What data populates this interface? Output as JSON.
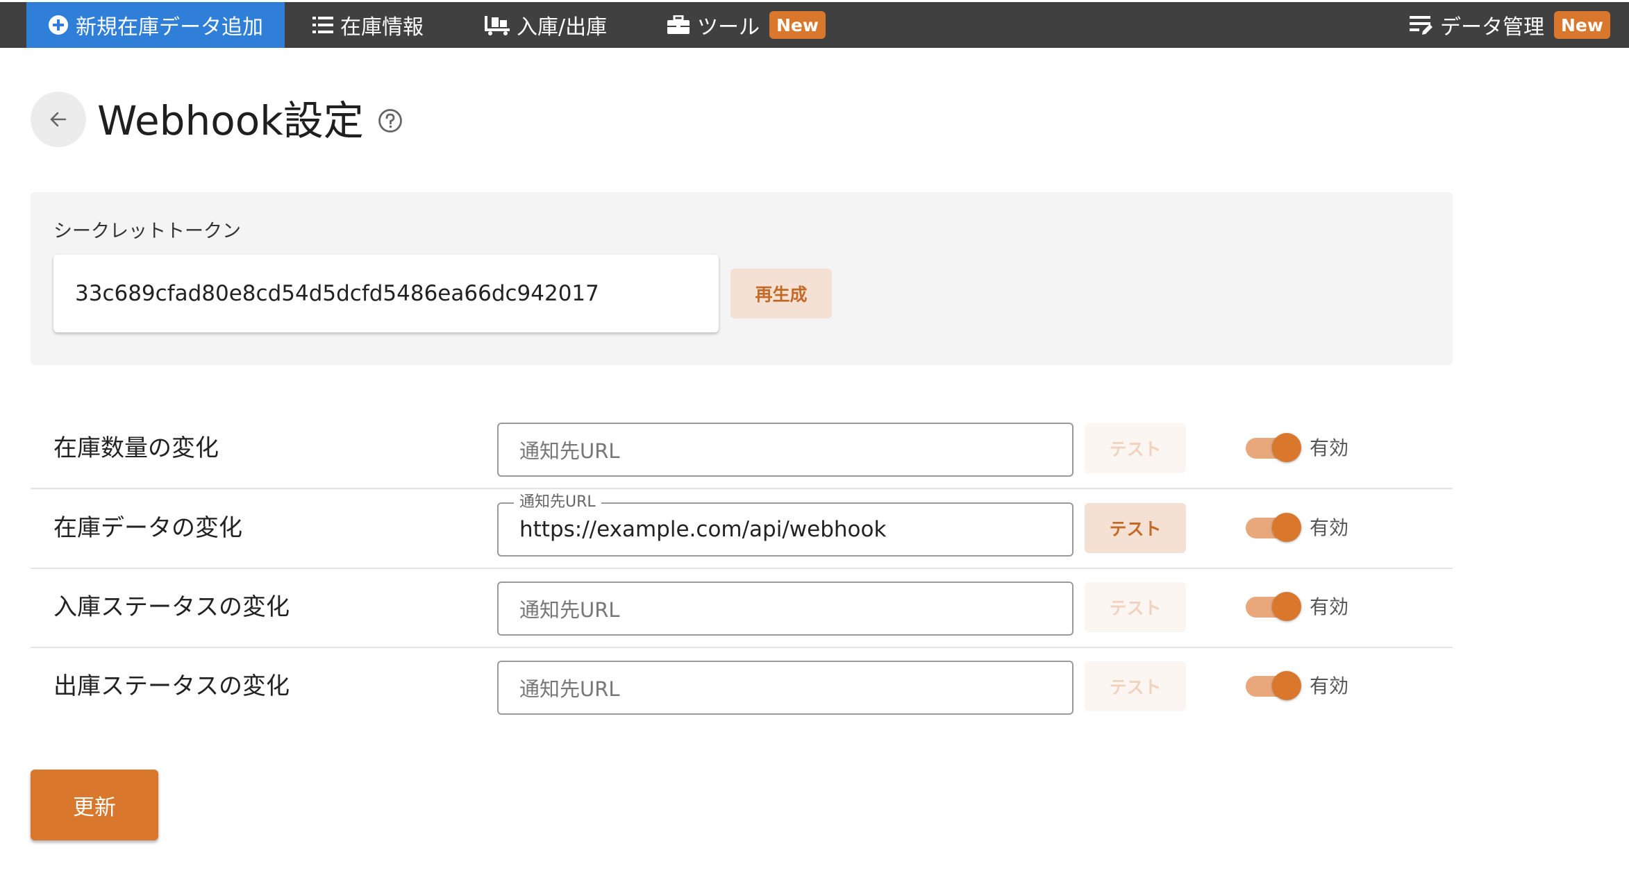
{
  "nav": {
    "add_new": "新規在庫データ追加",
    "inventory_info": "在庫情報",
    "in_out": "入庫/出庫",
    "tools": "ツール",
    "tools_badge": "New",
    "data_management": "データ管理",
    "data_management_badge": "New"
  },
  "header": {
    "title": "Webhook設定"
  },
  "secret": {
    "label": "シークレットトークン",
    "value": "33c689cfad80e8cd54d5dcfd5486ea66dc942017",
    "regenerate_label": "再生成"
  },
  "webhooks": [
    {
      "label": "在庫数量の変化",
      "url": "",
      "placeholder": "通知先URL",
      "test_label": "テスト",
      "test_enabled": false,
      "enabled": true,
      "enabled_label": "有効"
    },
    {
      "label": "在庫データの変化",
      "url": "https://example.com/api/webhook",
      "placeholder": "通知先URL",
      "test_label": "テスト",
      "test_enabled": true,
      "enabled": true,
      "enabled_label": "有効"
    },
    {
      "label": "入庫ステータスの変化",
      "url": "",
      "placeholder": "通知先URL",
      "test_label": "テスト",
      "test_enabled": false,
      "enabled": true,
      "enabled_label": "有効"
    },
    {
      "label": "出庫ステータスの変化",
      "url": "",
      "placeholder": "通知先URL",
      "test_label": "テスト",
      "test_enabled": false,
      "enabled": true,
      "enabled_label": "有効"
    }
  ],
  "actions": {
    "update_label": "更新"
  },
  "colors": {
    "nav_bg": "#404040",
    "nav_active": "#2f7fd8",
    "accent": "#d9772c",
    "accent_light": "#f4e1d3"
  }
}
